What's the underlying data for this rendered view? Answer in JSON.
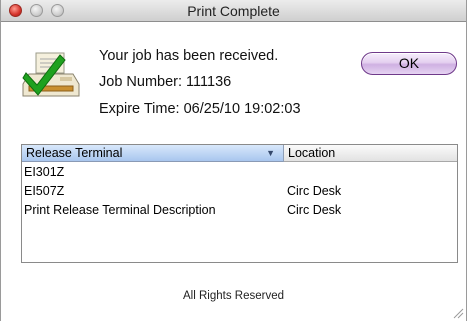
{
  "window": {
    "title": "Print Complete"
  },
  "message": {
    "line1": "Your job has been received.",
    "line2": "Job Number: 111136",
    "line3": "Expire Time: 06/25/10 19:02:03"
  },
  "ok_button": {
    "label": "OK"
  },
  "table": {
    "columns": [
      "Release Terminal",
      "Location"
    ],
    "sort_indicator": "▼",
    "rows": [
      {
        "terminal": "EI301Z",
        "location": ""
      },
      {
        "terminal": "EI507Z",
        "location": "Circ Desk"
      },
      {
        "terminal": "Print Release Terminal Description",
        "location": "Circ Desk"
      }
    ]
  },
  "footer": {
    "text": "All Rights Reserved"
  },
  "icons": {
    "app": "printer-with-checkmark-icon",
    "window_controls": [
      "close-icon",
      "minimize-icon",
      "zoom-icon"
    ],
    "resize": "resize-grip-icon"
  },
  "colors": {
    "ok_button": "#dcc4ec",
    "selected_header": "#b9d2f2",
    "close": "#d5342c"
  }
}
